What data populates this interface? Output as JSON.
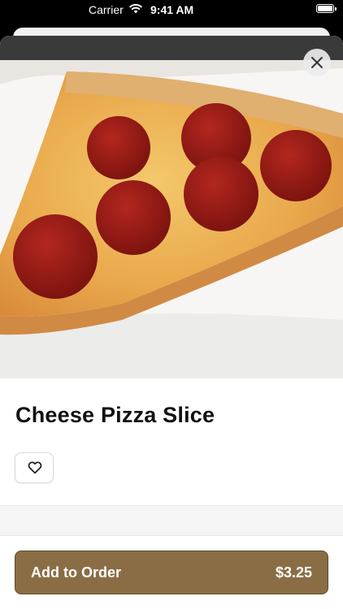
{
  "status_bar": {
    "carrier": "Carrier",
    "time": "9:41 AM",
    "wifi_icon": "wifi-icon",
    "battery_icon": "battery-icon"
  },
  "item": {
    "image_alt": "",
    "title": "Cheese Pizza Slice",
    "favorite_icon": "heart-outline-icon",
    "close_icon": "close-icon"
  },
  "order": {
    "button_label": "Add to Order",
    "price": "$3.25"
  },
  "colors": {
    "accent": "#8a6d45",
    "accent_border": "#5e4929"
  }
}
